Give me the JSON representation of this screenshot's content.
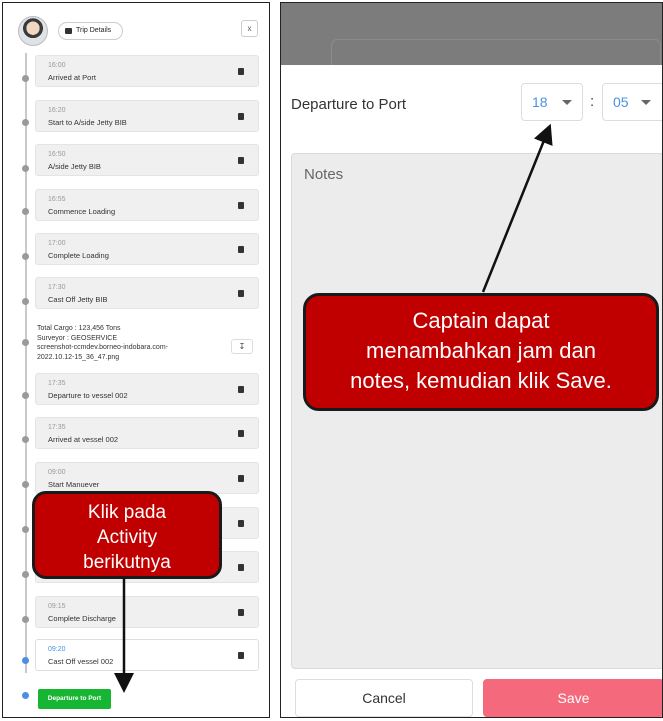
{
  "left": {
    "header": {
      "trip_label": "Trip Details",
      "close_label": "x"
    },
    "activities": [
      {
        "time": "16:00",
        "name": "Arrived at Port"
      },
      {
        "time": "16:20",
        "name": "Start to A/side Jetty BIB"
      },
      {
        "time": "16:50",
        "name": "A/side Jetty BIB"
      },
      {
        "time": "16:55",
        "name": "Commence Loading"
      },
      {
        "time": "17:00",
        "name": "Complete Loading"
      },
      {
        "time": "17:30",
        "name": "Cast Off Jetty BIB"
      },
      {
        "time": "17:35",
        "name": "Departure to vessel 002"
      },
      {
        "time": "17:35",
        "name": "Arrived at vessel 002"
      },
      {
        "time": "09:00",
        "name": "Start Manuever"
      },
      {
        "time": "09:15",
        "name": "Complete Discharge"
      },
      {
        "time": "09:20",
        "name": "Cast Off vessel 002"
      }
    ],
    "cargo_info": {
      "line1": "Total Cargo : 123,456 Tons",
      "line2": "Surveyor : GEOSERVICE",
      "line3": "screenshot-ccmdev.borneo-indobara.com-",
      "line4": "2022.10.12-15_36_47.png"
    },
    "next_button": "Departure to Port",
    "callout": {
      "line1": "Klik pada",
      "line2": "Activity",
      "line3": "berikutnya"
    }
  },
  "right": {
    "field_label": "Departure to Port",
    "hour": "18",
    "minute": "05",
    "colon": ":",
    "notes_placeholder": "Notes",
    "cancel_label": "Cancel",
    "save_label": "Save",
    "callout": {
      "line1": "Captain dapat",
      "line2": "menambahkan jam dan",
      "line3": "notes, kemudian klik Save."
    }
  },
  "colors": {
    "accent_green": "#16b532",
    "save_pink": "#f46a7c",
    "callout_red": "#c00000",
    "time_blue": "#4a90e2"
  },
  "icons": [
    "avatar",
    "trip-icon",
    "close-icon",
    "doc-icon",
    "download-icon",
    "caret-down-icon"
  ]
}
